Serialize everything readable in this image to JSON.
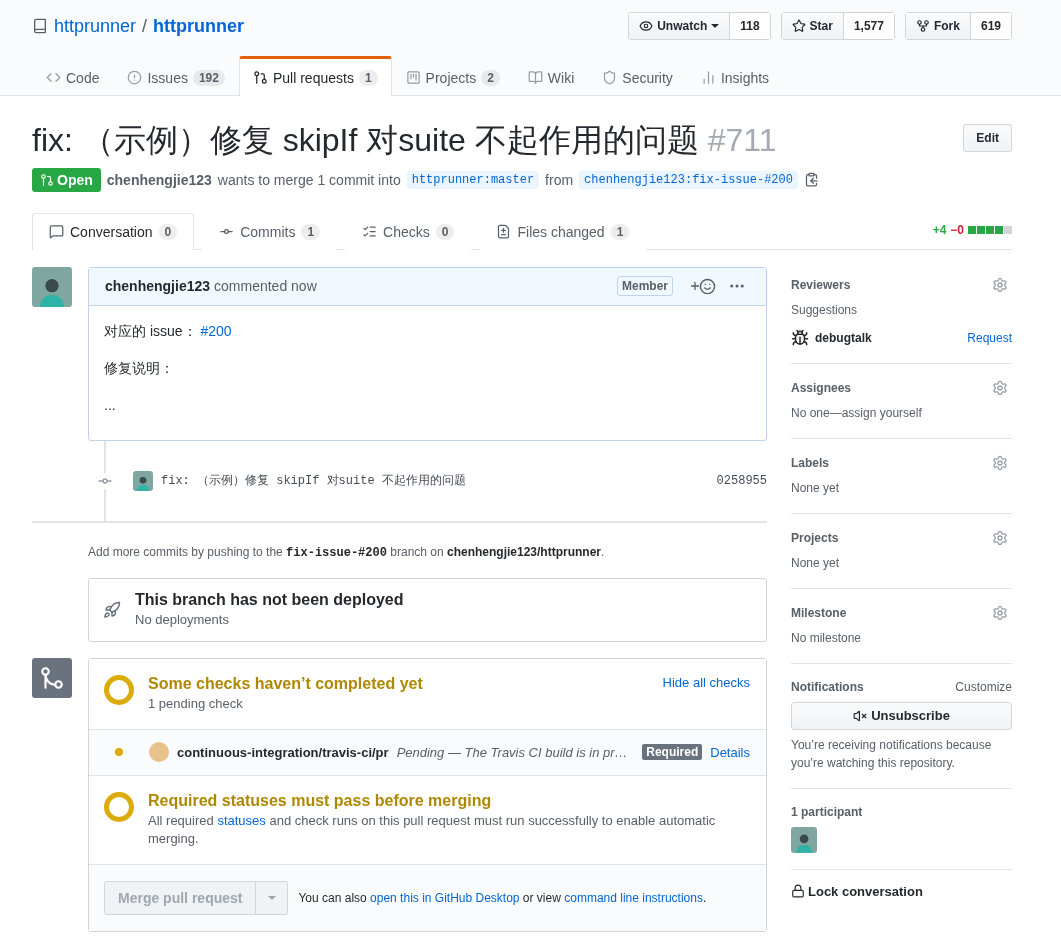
{
  "repo": {
    "owner": "httprunner",
    "separator": "/",
    "name": "httprunner"
  },
  "repo_actions": [
    {
      "kind": "watch",
      "label": "Unwatch",
      "count": "118"
    },
    {
      "kind": "star",
      "label": "Star",
      "count": "1,577"
    },
    {
      "kind": "fork",
      "label": "Fork",
      "count": "619"
    }
  ],
  "nav_tabs": [
    {
      "kind": "code",
      "label": "Code",
      "selected": false
    },
    {
      "kind": "issues",
      "label": "Issues",
      "count": "192",
      "selected": false
    },
    {
      "kind": "pulls",
      "label": "Pull requests",
      "count": "1",
      "selected": true
    },
    {
      "kind": "projects",
      "label": "Projects",
      "count": "2",
      "selected": false
    },
    {
      "kind": "wiki",
      "label": "Wiki",
      "selected": false
    },
    {
      "kind": "security",
      "label": "Security",
      "selected": false
    },
    {
      "kind": "insights",
      "label": "Insights",
      "selected": false
    }
  ],
  "pr": {
    "title": "fix: （示例）修复 skipIf 对suite 不起作用的问题",
    "number": "#711",
    "edit_button": "Edit",
    "state_label": "Open",
    "author": "chenhengjie123",
    "merge_text": "wants to merge 1 commit into",
    "base_branch": "httprunner:master",
    "from_text": "from",
    "head_branch": "chenhengjie123:fix-issue-#200"
  },
  "pr_tabs": [
    {
      "kind": "conversation",
      "label": "Conversation",
      "count": "0",
      "selected": true
    },
    {
      "kind": "commits",
      "label": "Commits",
      "count": "1",
      "selected": false
    },
    {
      "kind": "checks",
      "label": "Checks",
      "count": "0",
      "selected": false
    },
    {
      "kind": "files",
      "label": "Files changed",
      "count": "1",
      "selected": false
    }
  ],
  "diffstat": {
    "additions": "+4",
    "deletions": "−0",
    "level": 0.8
  },
  "comment": {
    "author": "chenhengjie123",
    "action": "commented now",
    "badge": "Member",
    "body": [
      {
        "text": "对应的 issue：",
        "link": "#200"
      },
      {
        "text": "修复说明："
      },
      {
        "text": "..."
      }
    ]
  },
  "commit": {
    "message": "fix: （示例）修复 skipIf 对suite 不起作用的问题",
    "sha": "0258955"
  },
  "push_note": {
    "before": "Add more commits by pushing to the",
    "branch": "fix-issue-#200",
    "middle": "branch on",
    "repo": "chenhengjie123/httprunner",
    "after": "."
  },
  "deployment": {
    "title": "This branch has not been deployed",
    "subtitle": "No deployments"
  },
  "checks": {
    "title": "Some checks haven’t completed yet",
    "subtitle": "1 pending check",
    "toggle": "Hide all checks",
    "items": [
      {
        "color": "#dbab09",
        "name": "continuous-integration/travis-ci/pr",
        "description": "Pending — The Travis CI build is in pr…",
        "badge": "Required",
        "link": "Details"
      }
    ]
  },
  "required": {
    "title": "Required statuses must pass before merging",
    "before": "All required",
    "link": "statuses",
    "after": "and check runs on this pull request must run successfully to enable automatic merging."
  },
  "merge": {
    "button": "Merge pull request",
    "disabled": true,
    "before": "You can also",
    "link1": "open this in GitHub Desktop",
    "middle": "or view",
    "link2": "command line instructions",
    "after": "."
  },
  "sidebar": [
    {
      "kind": "reviewers",
      "title": "Reviewers",
      "subtitle": "Suggestions",
      "name": "debugtalk",
      "action": "Request"
    },
    {
      "kind": "text",
      "title": "Assignees",
      "value": "No one—assign yourself"
    },
    {
      "kind": "text",
      "title": "Labels",
      "value": "None yet"
    },
    {
      "kind": "text",
      "title": "Projects",
      "value": "None yet"
    },
    {
      "kind": "text",
      "title": "Milestone",
      "value": "No milestone"
    },
    {
      "kind": "notifications",
      "title": "Notifications",
      "action": "Customize",
      "button": "Unsubscribe",
      "note": "You’re receiving notifications because you’re watching this repository."
    },
    {
      "kind": "participants",
      "title": "1 participant"
    },
    {
      "kind": "lock",
      "title": "Lock conversation"
    }
  ]
}
